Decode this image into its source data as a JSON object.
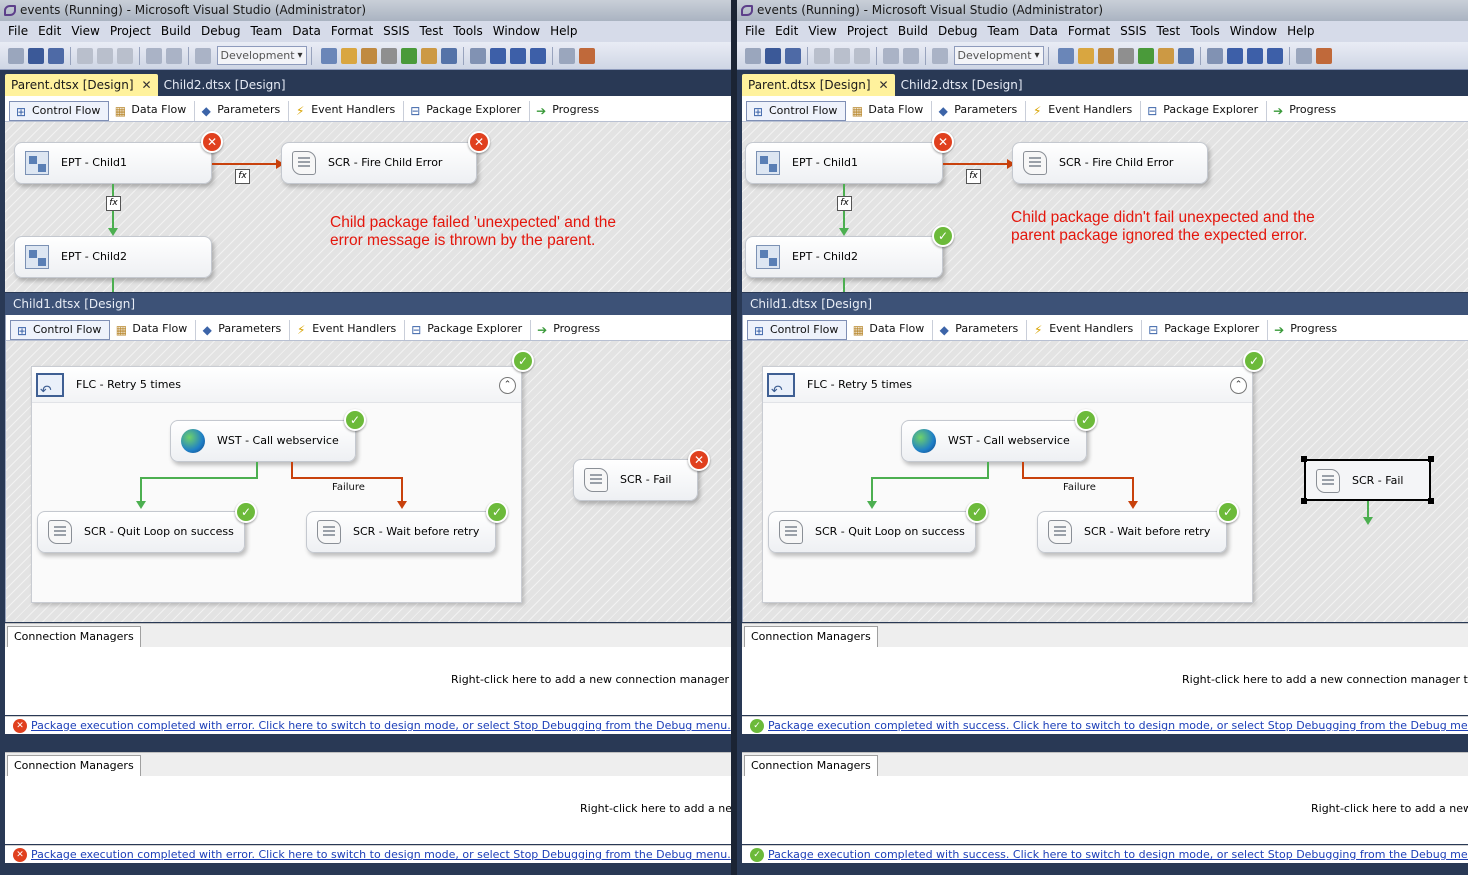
{
  "window_title": "events (Running) - Microsoft Visual Studio (Administrator)",
  "menu": [
    "File",
    "Edit",
    "View",
    "Project",
    "Build",
    "Debug",
    "Team",
    "Data",
    "Format",
    "SSIS",
    "Test",
    "Tools",
    "Window",
    "Help"
  ],
  "toolbar": {
    "configuration": "Development"
  },
  "doc_tabs": {
    "parent": "Parent.dtsx [Design]",
    "child2": "Child2.dtsx [Design]",
    "close": "✕"
  },
  "designer_tabs": {
    "control_flow": "Control Flow",
    "data_flow": "Data Flow",
    "parameters": "Parameters",
    "event_handlers": "Event Handlers",
    "package_explorer": "Package Explorer",
    "progress": "Progress"
  },
  "parent_tasks": {
    "ept_child1": "EPT - Child1",
    "ept_child2": "EPT - Child2",
    "scr_fire": "SCR - Fire Child Error",
    "fx": "fx"
  },
  "child1_title": "Child1.dtsx [Design]",
  "child1_tasks": {
    "flc": "FLC - Retry 5 times",
    "wst": "WST - Call webservice",
    "quit": "SCR - Quit Loop on success",
    "wait": "SCR - Wait before retry",
    "fail": "SCR - Fail",
    "failure_label": "Failure"
  },
  "connection_managers": {
    "tab": "Connection Managers",
    "hint": "Right-click here to add a new connection manager to the SSIS",
    "hint_short": "Right-click here to add a new co"
  },
  "left": {
    "annotation_line1": "Child package failed 'unexpected' and the",
    "annotation_line2": "error message is thrown by the parent.",
    "status": "Package execution completed with error. Click here to switch to design mode, or select Stop Debugging from the Debug menu."
  },
  "right": {
    "annotation_line1": "Child package didn't fail unexpected and the",
    "annotation_line2": "parent package ignored the expected error.",
    "status": "Package execution completed with success. Click here to switch to design mode, or select Stop Debugging from the Debug menu."
  },
  "colors": {
    "error": "#e0401e",
    "success": "#6cba3a",
    "annotation": "#e4160c",
    "active_tab": "#fff29d"
  }
}
